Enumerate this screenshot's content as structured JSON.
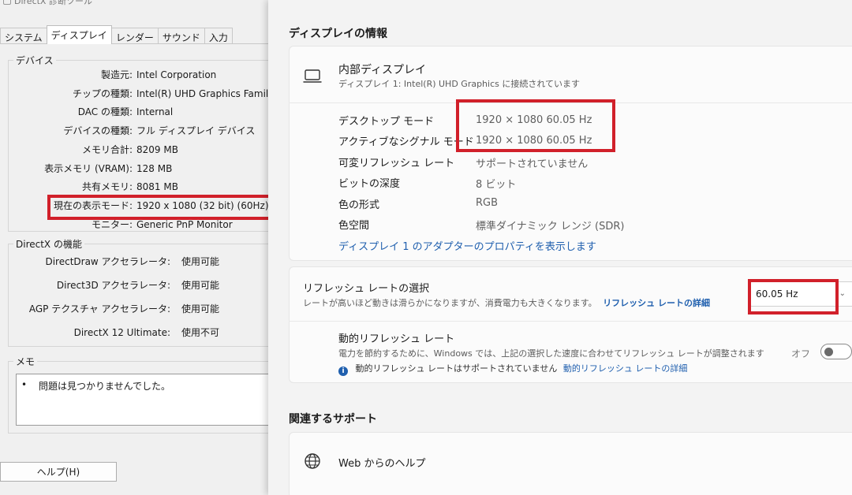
{
  "dxdiag": {
    "title": "DirectX 診断ツール",
    "tabs": [
      {
        "label": "システム"
      },
      {
        "label": "ディスプレイ",
        "active": true
      },
      {
        "label": "レンダー"
      },
      {
        "label": "サウンド"
      },
      {
        "label": "入力"
      }
    ],
    "device_group": {
      "label": "デバイス",
      "rows": [
        {
          "key": "製造元:",
          "value": "Intel Corporation"
        },
        {
          "key": "チップの種類:",
          "value": "Intel(R) UHD Graphics Family"
        },
        {
          "key": "DAC の種類:",
          "value": "Internal"
        },
        {
          "key": "デバイスの種類:",
          "value": "フル ディスプレイ デバイス"
        },
        {
          "key": "メモリ合計:",
          "value": "8209 MB"
        },
        {
          "key": "表示メモリ (VRAM):",
          "value": "128 MB"
        },
        {
          "key": "共有メモリ:",
          "value": "8081 MB"
        },
        {
          "key": "現在の表示モード:",
          "value": "1920 x 1080 (32 bit) (60Hz)"
        },
        {
          "key": "モニター:",
          "value": "Generic PnP Monitor"
        }
      ]
    },
    "directx_group": {
      "label": "DirectX の機能",
      "rows": [
        {
          "key": "DirectDraw アクセラレータ:",
          "value": "使用可能"
        },
        {
          "key": "Direct3D アクセラレータ:",
          "value": "使用可能"
        },
        {
          "key": "AGP テクスチャ アクセラレータ:",
          "value": "使用可能"
        },
        {
          "key": "DirectX 12 Ultimate:",
          "value": "使用不可"
        }
      ]
    },
    "memo_group": {
      "label": "メモ",
      "bullet": "•",
      "text": "問題は見つかりませんでした。"
    },
    "help_button": "ヘルプ(H)"
  },
  "settings": {
    "display_info_title": "ディスプレイの情報",
    "display_name": "内部ディスプレイ",
    "display_subtitle": "ディスプレイ 1: Intel(R) UHD Graphics に接続されています",
    "info_rows": [
      {
        "label": "デスクトップ モード",
        "value": "1920 × 1080 60.05 Hz"
      },
      {
        "label": "アクティブなシグナル モード",
        "value": "1920 × 1080 60.05 Hz"
      },
      {
        "label": "可変リフレッシュ レート",
        "value": "サポートされていません"
      },
      {
        "label": "ビットの深度",
        "value": "8 ビット"
      },
      {
        "label": "色の形式",
        "value": "RGB"
      },
      {
        "label": "色空間",
        "value": "標準ダイナミック レンジ (SDR)"
      }
    ],
    "adapter_link": "ディスプレイ 1 のアダプターのプロパティを表示します",
    "refresh": {
      "title": "リフレッシュ レートの選択",
      "description": "レートが高いほど動きは滑らかになりますが、消費電力も大きくなります。",
      "details_link": "リフレッシュ レートの詳細",
      "selected_value": "60.05 Hz"
    },
    "dynamic_refresh": {
      "title": "動的リフレッシュ レート",
      "description": "電力を節約するために、Windows では、上記の選択した速度に合わせてリフレッシュ レートが調整されます",
      "info_text": "動的リフレッシュ レートはサポートされていません",
      "info_link": "動的リフレッシュ レートの詳細",
      "toggle_label": "オフ",
      "toggle_on": false
    },
    "related_support_title": "関連するサポート",
    "web_help_label": "Web からのヘルプ"
  },
  "colors": {
    "highlight_red": "#d1202a",
    "link_blue": "#1f5fae"
  },
  "icons": [
    "app-icon",
    "laptop-icon",
    "globe-icon",
    "info-icon",
    "chevron-down-icon"
  ]
}
